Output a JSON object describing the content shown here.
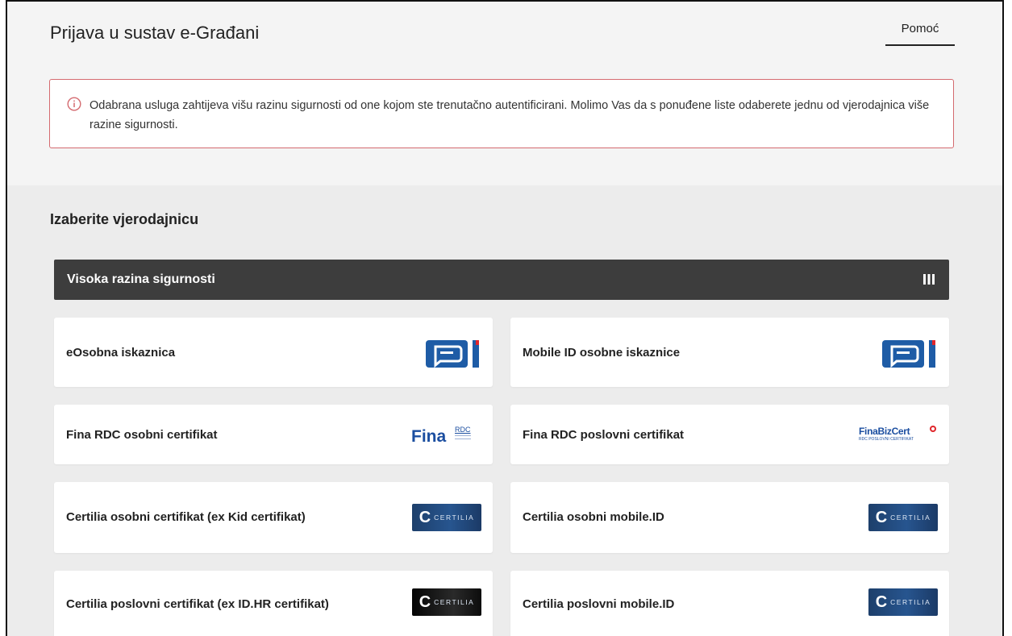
{
  "header": {
    "title": "Prijava u sustav e-Građani",
    "help_label": "Pomoć"
  },
  "alert": {
    "message": "Odabrana usluga zahtijeva višu razinu sigurnosti od one kojom ste trenutačno autentificirani. Molimo Vas da s ponuđene liste odaberete jednu od vjerodajnica više razine sigurnosti.",
    "color": "#d46a6f"
  },
  "section": {
    "title": "Izaberite vjerodajnicu"
  },
  "level": {
    "label": "Visoka razina sigurnosti"
  },
  "credentials": [
    {
      "label": "eOsobna iskaznica",
      "logo": "eoi-icon"
    },
    {
      "label": "Mobile ID osobne iskaznice",
      "logo": "eoi-icon"
    },
    {
      "label": "Fina RDC osobni certifikat",
      "logo": "fina-rdc-logo",
      "logo_text": "Fina",
      "logo_sub": "RDC"
    },
    {
      "label": "Fina RDC poslovni certifikat",
      "logo": "fina-bizcert-logo",
      "logo_text": "FinaBizCert",
      "logo_sub": "RDC POSLOVNI CERTIFIKAT"
    },
    {
      "label": "Certilia osobni certifikat (ex Kid certifikat)",
      "logo": "certilia-logo",
      "logo_text": "CERTILIA"
    },
    {
      "label": "Certilia osobni mobile.ID",
      "logo": "certilia-logo",
      "logo_text": "CERTILIA"
    },
    {
      "label": "Certilia poslovni certifikat (ex ID.HR certifikat)",
      "logo": "certilia-logo",
      "logo_text": "CERTILIA"
    },
    {
      "label": "Certilia poslovni mobile.ID",
      "logo": "certilia-logo",
      "logo_text": "CERTILIA"
    }
  ],
  "colors": {
    "eoi_blue": "#1e5ca6",
    "eoi_red": "#e0262b",
    "fina_blue": "#1b4ea0",
    "certilia_blue": "#27558f",
    "dark_bar": "#3d3d3d"
  }
}
